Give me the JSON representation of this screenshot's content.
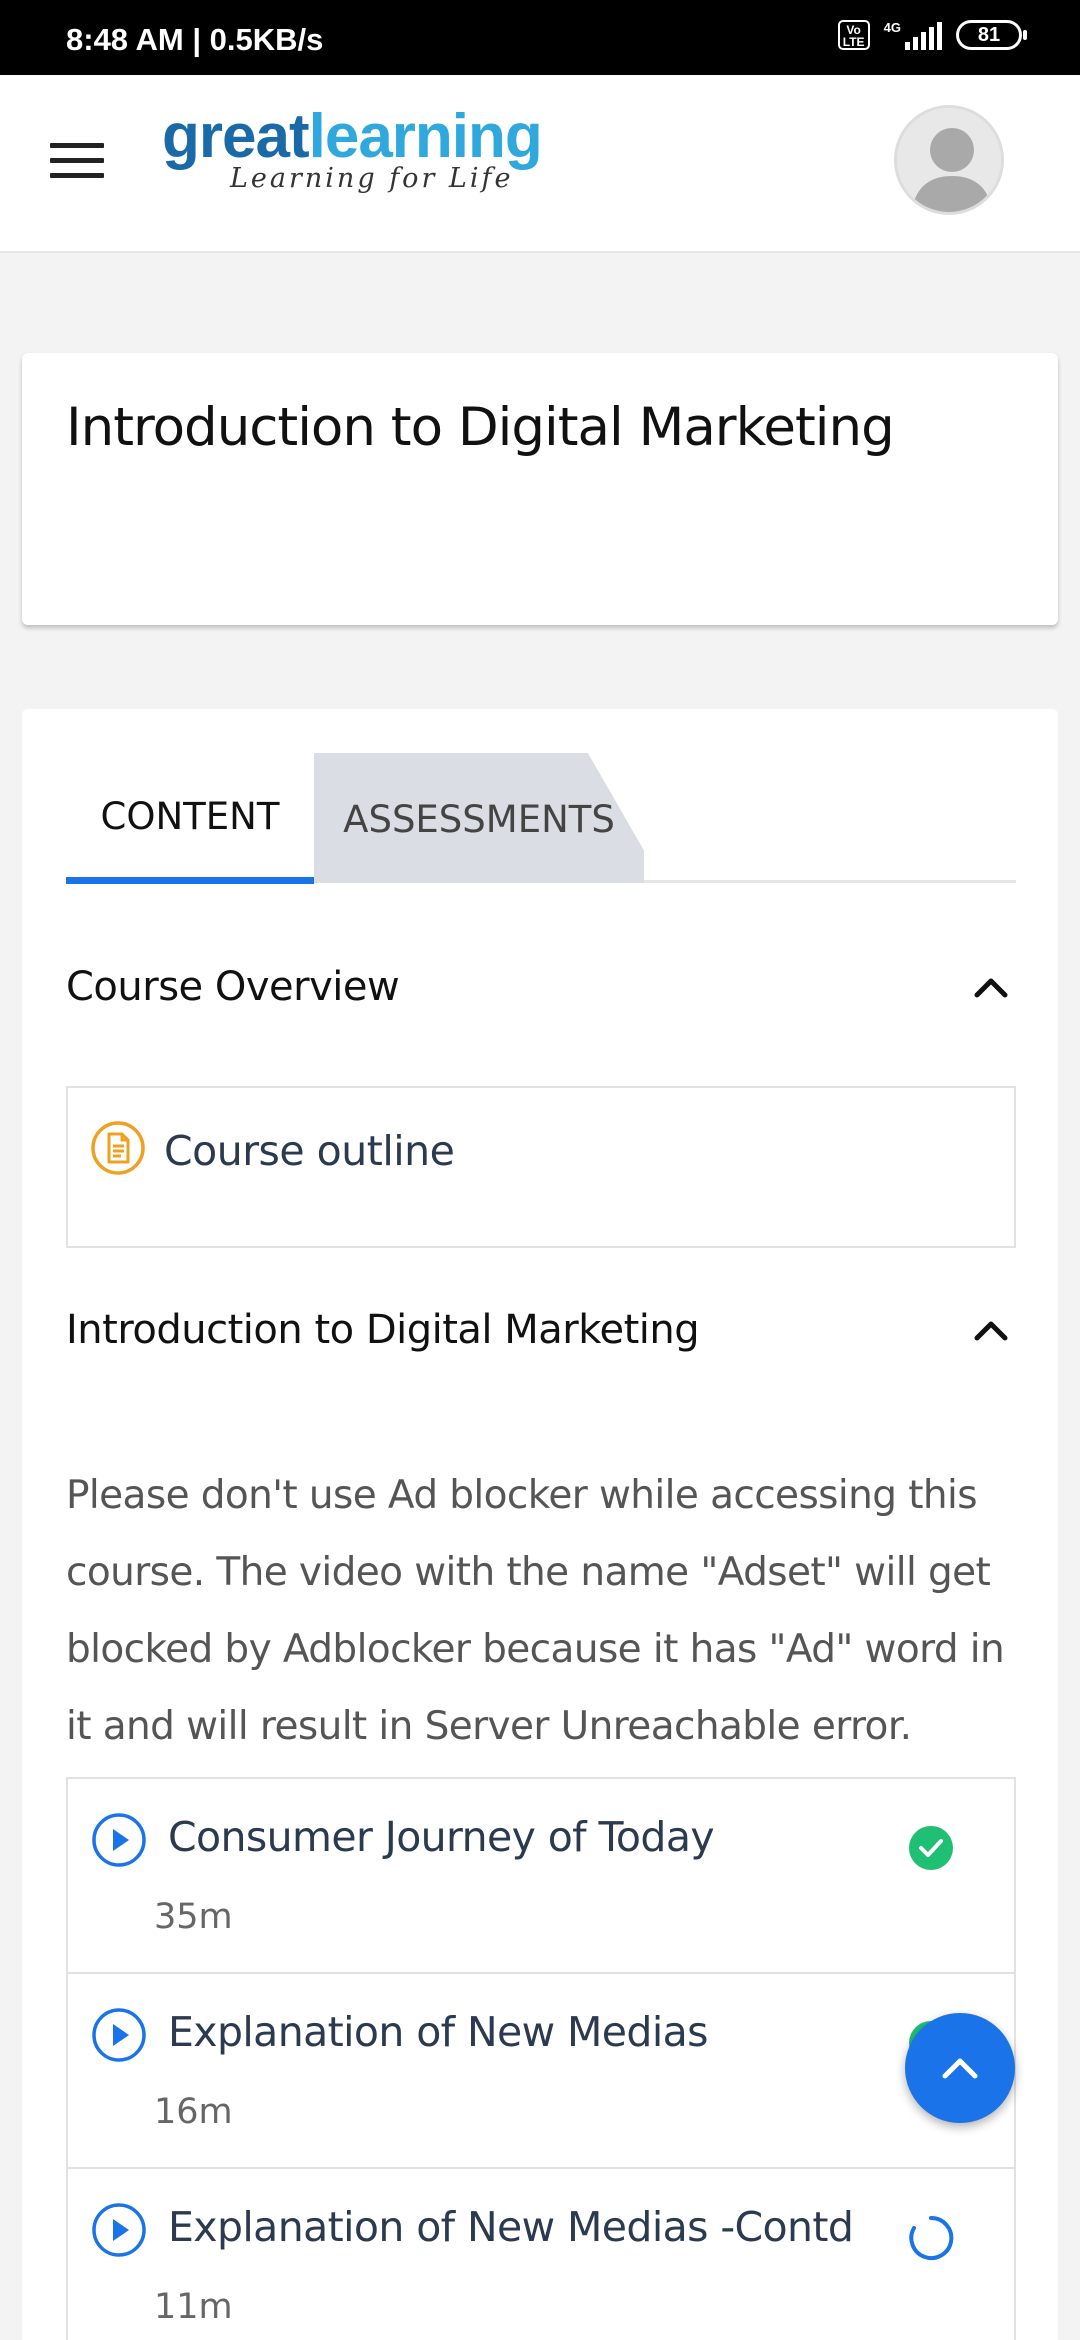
{
  "status_bar": {
    "time": "8:48 AM | 0.5KB/s",
    "volte": "Vo LTE",
    "network": "4G",
    "battery": "81"
  },
  "header": {
    "logo_part1": "great",
    "logo_part2": "learning",
    "logo_tagline": "Learning for Life",
    "menu_icon": "hamburger-menu-icon",
    "avatar_icon": "user-avatar-icon"
  },
  "course": {
    "title": "Introduction to Digital Marketing"
  },
  "tabs": [
    {
      "label": "CONTENT",
      "active": true
    },
    {
      "label": "ASSESSMENTS",
      "active": false
    }
  ],
  "sections": [
    {
      "title": "Course Overview",
      "expanded": true,
      "items": [
        {
          "label": "Course outline",
          "icon": "document-icon"
        }
      ]
    },
    {
      "title": "Introduction to Digital Marketing",
      "expanded": true,
      "notice": "Please don't use Ad blocker while accessing this course. The video with the name \"Adset\" will get blocked by Adblocker because it has \"Ad\" word in it and will result in Server Unreachable error.",
      "lessons": [
        {
          "name": "Consumer Journey of Today",
          "duration": "35m",
          "status": "completed"
        },
        {
          "name": "Explanation of New Medias",
          "duration": "16m",
          "status": "completed"
        },
        {
          "name": "Explanation of New Medias -Contd",
          "duration": "11m",
          "status": "in-progress"
        }
      ]
    }
  ],
  "colors": {
    "accent": "#1a73e8",
    "complete": "#1fbf74",
    "outline_icon": "#f0a020",
    "logo_dark": "#1a6aa8",
    "logo_light": "#2fa8de"
  },
  "fab_icon": "chevron-up-icon"
}
